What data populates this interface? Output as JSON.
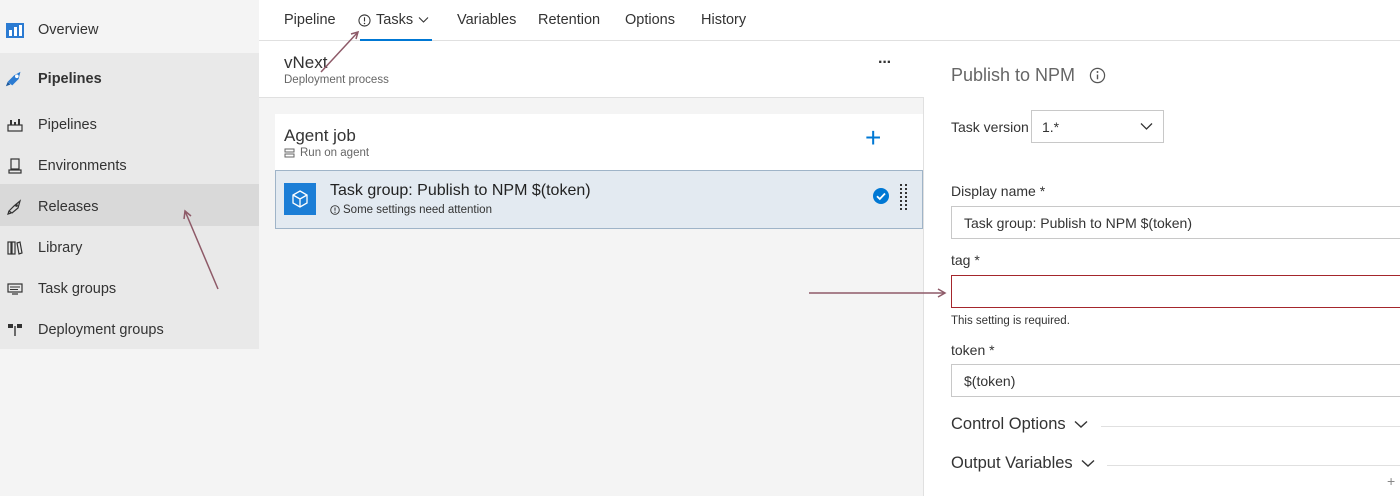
{
  "sidebar": {
    "items": [
      {
        "label": "Overview",
        "icon": "overview-icon"
      },
      {
        "label": "Pipelines",
        "icon": "pipelines-rocket-icon"
      },
      {
        "label": "Pipelines",
        "icon": "pipelines-icon"
      },
      {
        "label": "Environments",
        "icon": "environments-icon"
      },
      {
        "label": "Releases",
        "icon": "releases-icon"
      },
      {
        "label": "Library",
        "icon": "library-icon"
      },
      {
        "label": "Task groups",
        "icon": "task-groups-icon"
      },
      {
        "label": "Deployment groups",
        "icon": "deployment-groups-icon"
      }
    ]
  },
  "tabs": [
    {
      "label": "Pipeline"
    },
    {
      "label": "Tasks"
    },
    {
      "label": "Variables"
    },
    {
      "label": "Retention"
    },
    {
      "label": "Options"
    },
    {
      "label": "History"
    }
  ],
  "process": {
    "name": "vNext",
    "subtitle": "Deployment process",
    "more": "···"
  },
  "agent_job": {
    "title": "Agent job",
    "subtitle": "Run on agent",
    "add": "+"
  },
  "task": {
    "title": "Task group: Publish to NPM $(token)",
    "warning": "Some settings need attention"
  },
  "details": {
    "title": "Publish to NPM",
    "task_version_label": "Task version",
    "task_version_value": "1.*",
    "display_name_label": "Display name *",
    "display_name_value": "Task group: Publish to NPM $(token)",
    "tag_label": "tag *",
    "tag_value": "",
    "tag_error": "This setting is required.",
    "token_label": "token *",
    "token_value": "$(token)",
    "control_options": "Control Options",
    "output_variables": "Output Variables",
    "add": "+"
  },
  "colors": {
    "accent": "#0078d4",
    "error": "#a4262c",
    "annotation_arrow": "#8e5a68"
  }
}
